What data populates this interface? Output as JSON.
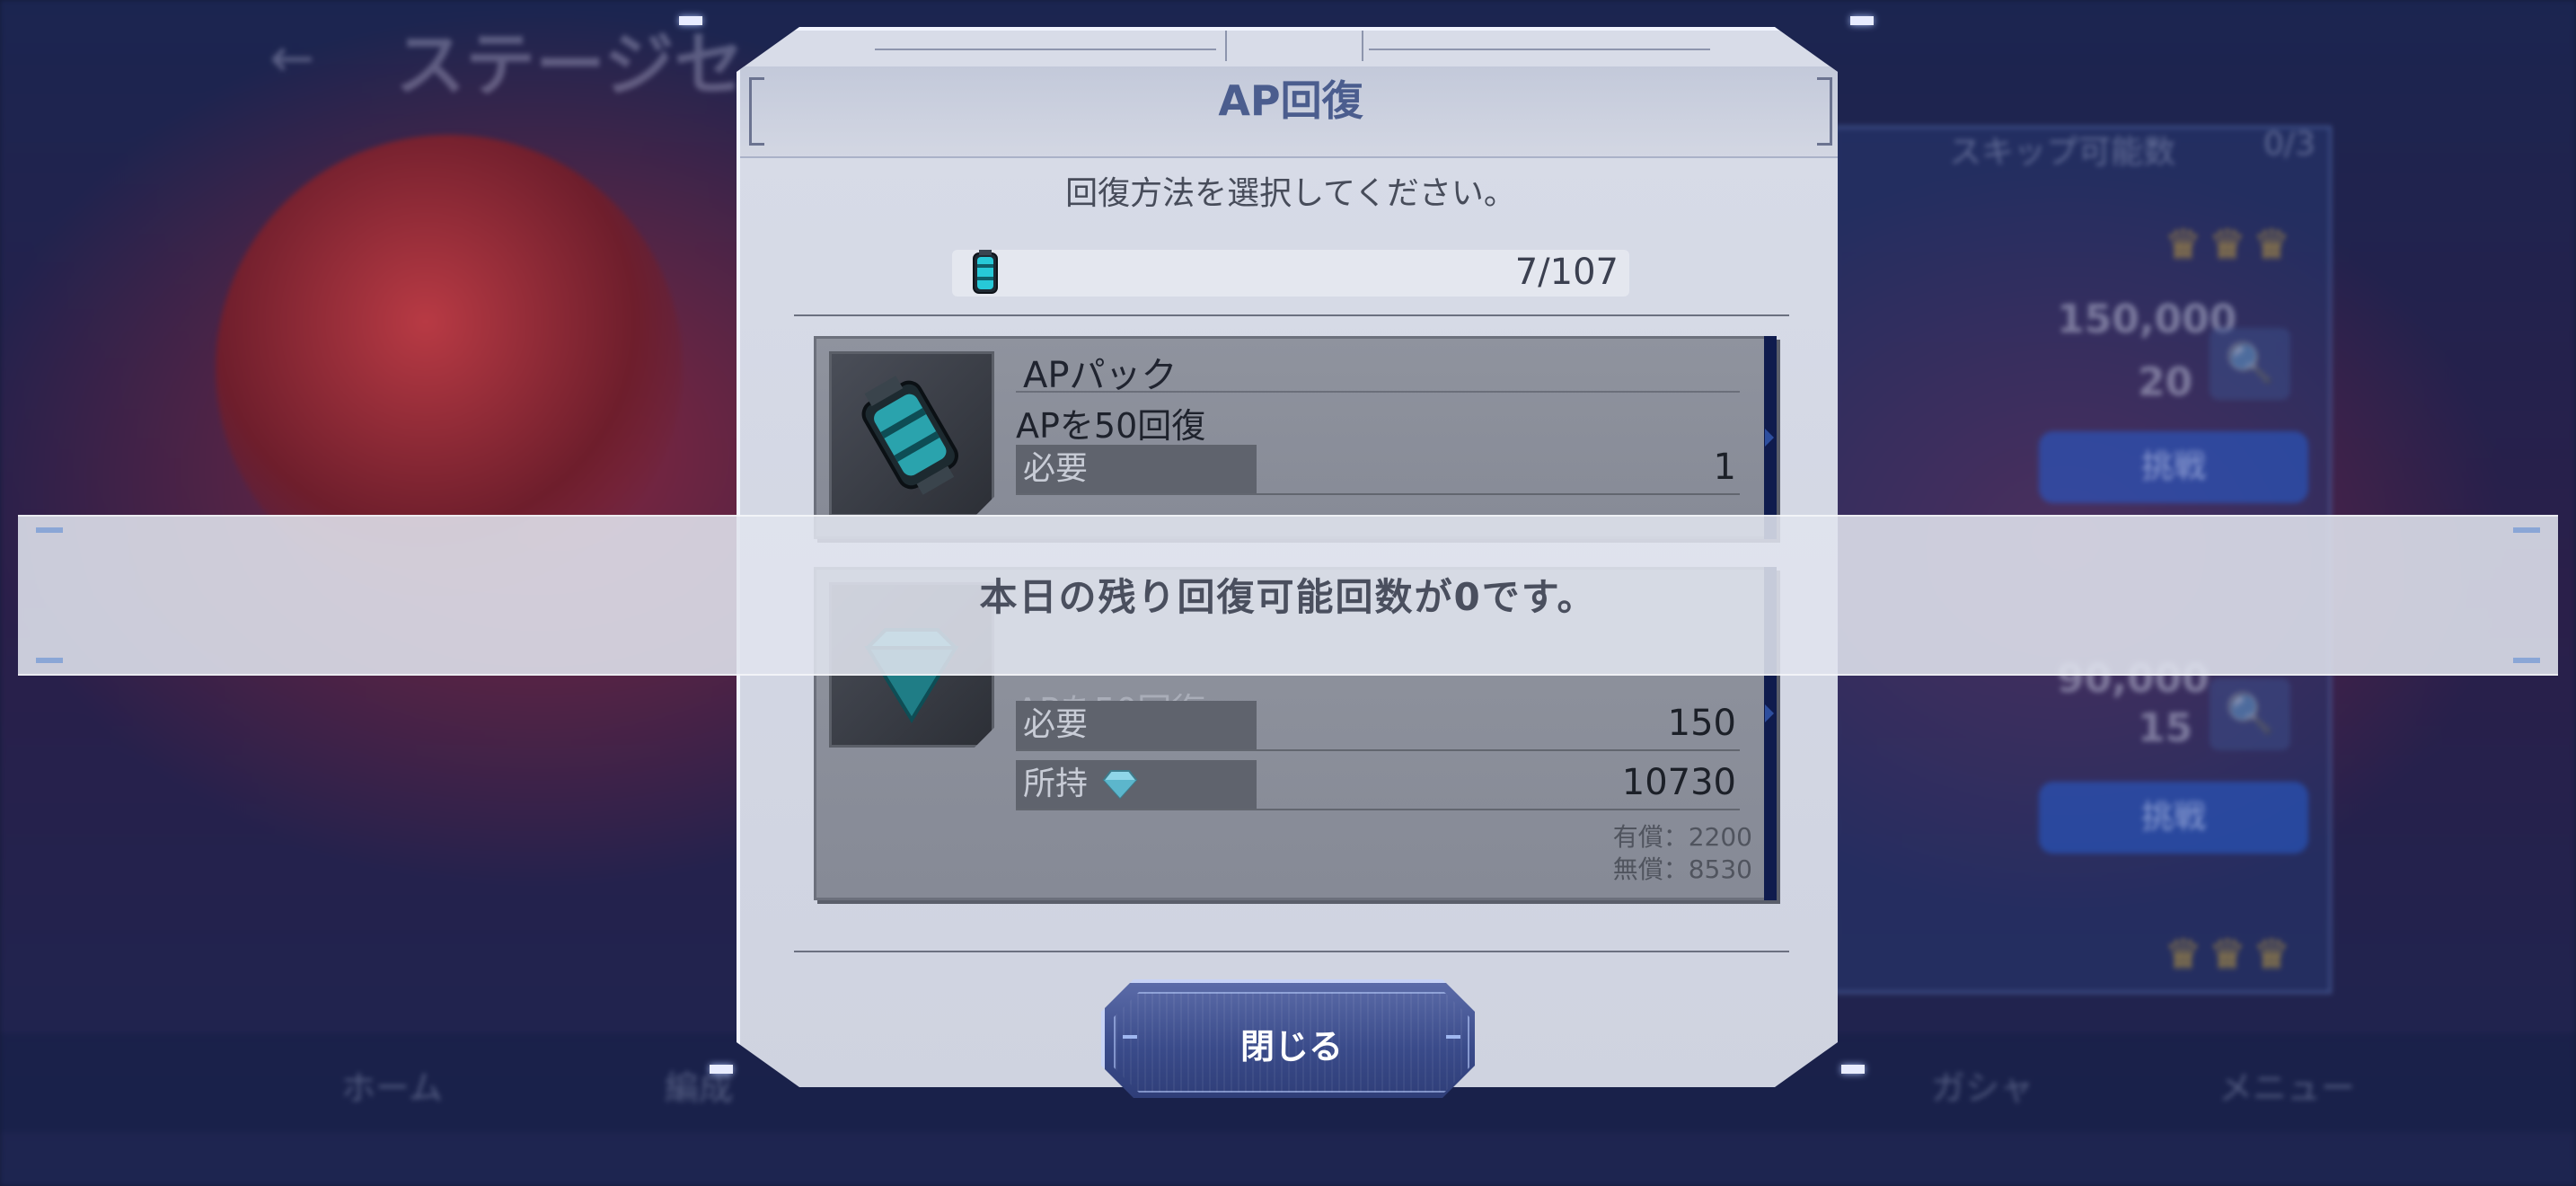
{
  "background": {
    "title": "ステージセ",
    "back": "←",
    "skip_label": "スキップ可能数",
    "skip_value": "0/3",
    "power_value": "150,000",
    "cost_value": "20",
    "power_value_2": "90,000",
    "cost_value_2": "15",
    "challenge_label": "挑戦",
    "search_icon": "🔍",
    "crowns": "♛♛♛",
    "nav": [
      "ホーム",
      "編成",
      "ガシャ",
      "メニュー"
    ]
  },
  "dialog": {
    "title": "AP回復",
    "subtitle": "回復方法を選択してください。",
    "ap_current": "7/107",
    "items": [
      {
        "name": "APパック",
        "desc": "APを50回復",
        "required_label": "必要",
        "required_value": "1"
      },
      {
        "desc": "APを50回復",
        "required_label": "必要",
        "required_value": "150",
        "owned_label": "所持",
        "owned_value": "10730",
        "paid_line": "有償：2200",
        "free_line": "無償：8530"
      }
    ],
    "close_label": "閉じる"
  },
  "banner": {
    "message": "本日の残り回復可能回数が0です。"
  },
  "colors": {
    "title": "#4b5d8e",
    "card": "#8f939e",
    "card_edge": "#0f1b4d",
    "button": "#3a4b8a"
  }
}
